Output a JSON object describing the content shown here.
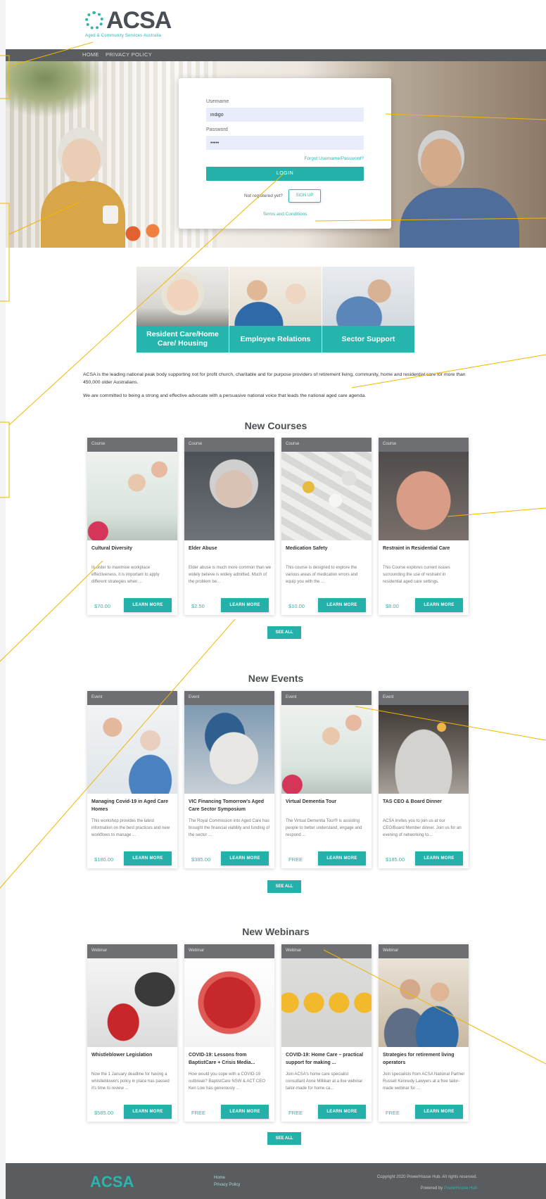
{
  "header": {
    "logo_text": "ACSA",
    "logo_subtext": "Aged & Community Services Australia",
    "nav": [
      "HOME",
      "PRIVACY POLICY"
    ]
  },
  "login": {
    "username_label": "Username",
    "username_value": "indigo",
    "password_label": "Password",
    "password_value": "•••••",
    "forgot_link": "Forgot Username/Password?",
    "login_button": "LOGIN",
    "not_registered": "Not registered yet?",
    "signup_button": "SIGN UP",
    "terms_link": "Terms and Conditions"
  },
  "categories": [
    {
      "label": "Resident Care/Home Care/ Housing"
    },
    {
      "label": "Employee Relations"
    },
    {
      "label": "Sector Support"
    }
  ],
  "intro": {
    "p1": "ACSA is the leading national peak body supporting not for profit church, charitable and for purpose providers of retirement living, community, home and residential care for more than 450,000 older Australians.",
    "p2": "We are committed to being a strong and effective advocate with a persuasive national voice that leads the national aged care agenda."
  },
  "sections": {
    "courses_title": "New Courses",
    "events_title": "New Events",
    "webinars_title": "New Webinars",
    "see_all": "SEE ALL",
    "learn_more": "LEARN MORE"
  },
  "courses": [
    {
      "type": "Course",
      "title": "Cultural Diversity",
      "desc": "In order to maximise workplace effectiveness, it is important to apply different strategies when ...",
      "price": "$70.00"
    },
    {
      "type": "Course",
      "title": "Elder Abuse",
      "desc": "Elder abuse is much more common than we widely believe is widely admitted. Much of the problem be...",
      "price": "$2.50"
    },
    {
      "type": "Course",
      "title": "Medication Safety",
      "desc": "This course is designed to explore the various areas of medication errors and equip you with the ...",
      "price": "$10.00"
    },
    {
      "type": "Course",
      "title": "Restraint in Residential Care",
      "desc": "This Course explores current issues surrounding the use of restraint in residential aged care settings.",
      "price": "$8.00"
    }
  ],
  "events": [
    {
      "type": "Event",
      "title": "Managing Covid-19 in Aged Care Homes",
      "desc": "This workshop provides the latest information on the best practices and new workflows to manage ...",
      "price": "$180.00"
    },
    {
      "type": "Event",
      "title": "VIC Financing Tomorrow's Aged Care Sector Symposium",
      "desc": "The Royal Commission into Aged Care has brought the financial viability and funding of the sector ...",
      "price": "$385.00"
    },
    {
      "type": "Event",
      "title": "Virtual Dementia Tour",
      "desc": "The Virtual Dementia Tour® is assisting people to better understand, engage and respond ...",
      "price": "FREE"
    },
    {
      "type": "Event",
      "title": "TAS CEO & Board Dinner",
      "desc": "ACSA invites you to join us at our CEO/Board Member dinner. Join us for an evening of networking to...",
      "price": "$185.00"
    }
  ],
  "webinars": [
    {
      "type": "Webinar",
      "title": "Whistleblower Legislation",
      "desc": "Now the 1 January deadline for having a whistleblowers policy in place has passed it's time to review ...",
      "price": "$585.00"
    },
    {
      "type": "Webinar",
      "title": "COVID-19: Lessons from BaptistCare + Crisis Media...",
      "desc": "How would you cope with a COVID-19 outbreak? BaptistCare NSW & ACT CEO Ken Low has generously ...",
      "price": "FREE"
    },
    {
      "type": "Webinar",
      "title": "COVID-19: Home Care – practical support for making ...",
      "desc": "Join ACSA's home care specialist consultant Anne Millikan at a live webinar tailor-made for home ca...",
      "price": "FREE"
    },
    {
      "type": "Webinar",
      "title": "Strategies for retirement living operators",
      "desc": "Join specialists from ACSA National Partner Russell Kennedy Lawyers at a free tailor-made webinar for ...",
      "price": "FREE"
    }
  ],
  "footer": {
    "logo_text": "ACSA",
    "links": [
      "Home",
      "Privacy Policy"
    ],
    "copyright": "Copyright 2020 PowerHouse Hub. All rights reserved.",
    "powered_prefix": "Powered by",
    "powered_link": "PowerHouse Hub"
  },
  "colors": {
    "accent": "#23b1aa",
    "nav": "#5a5d60",
    "annotation": "#f2b600"
  }
}
